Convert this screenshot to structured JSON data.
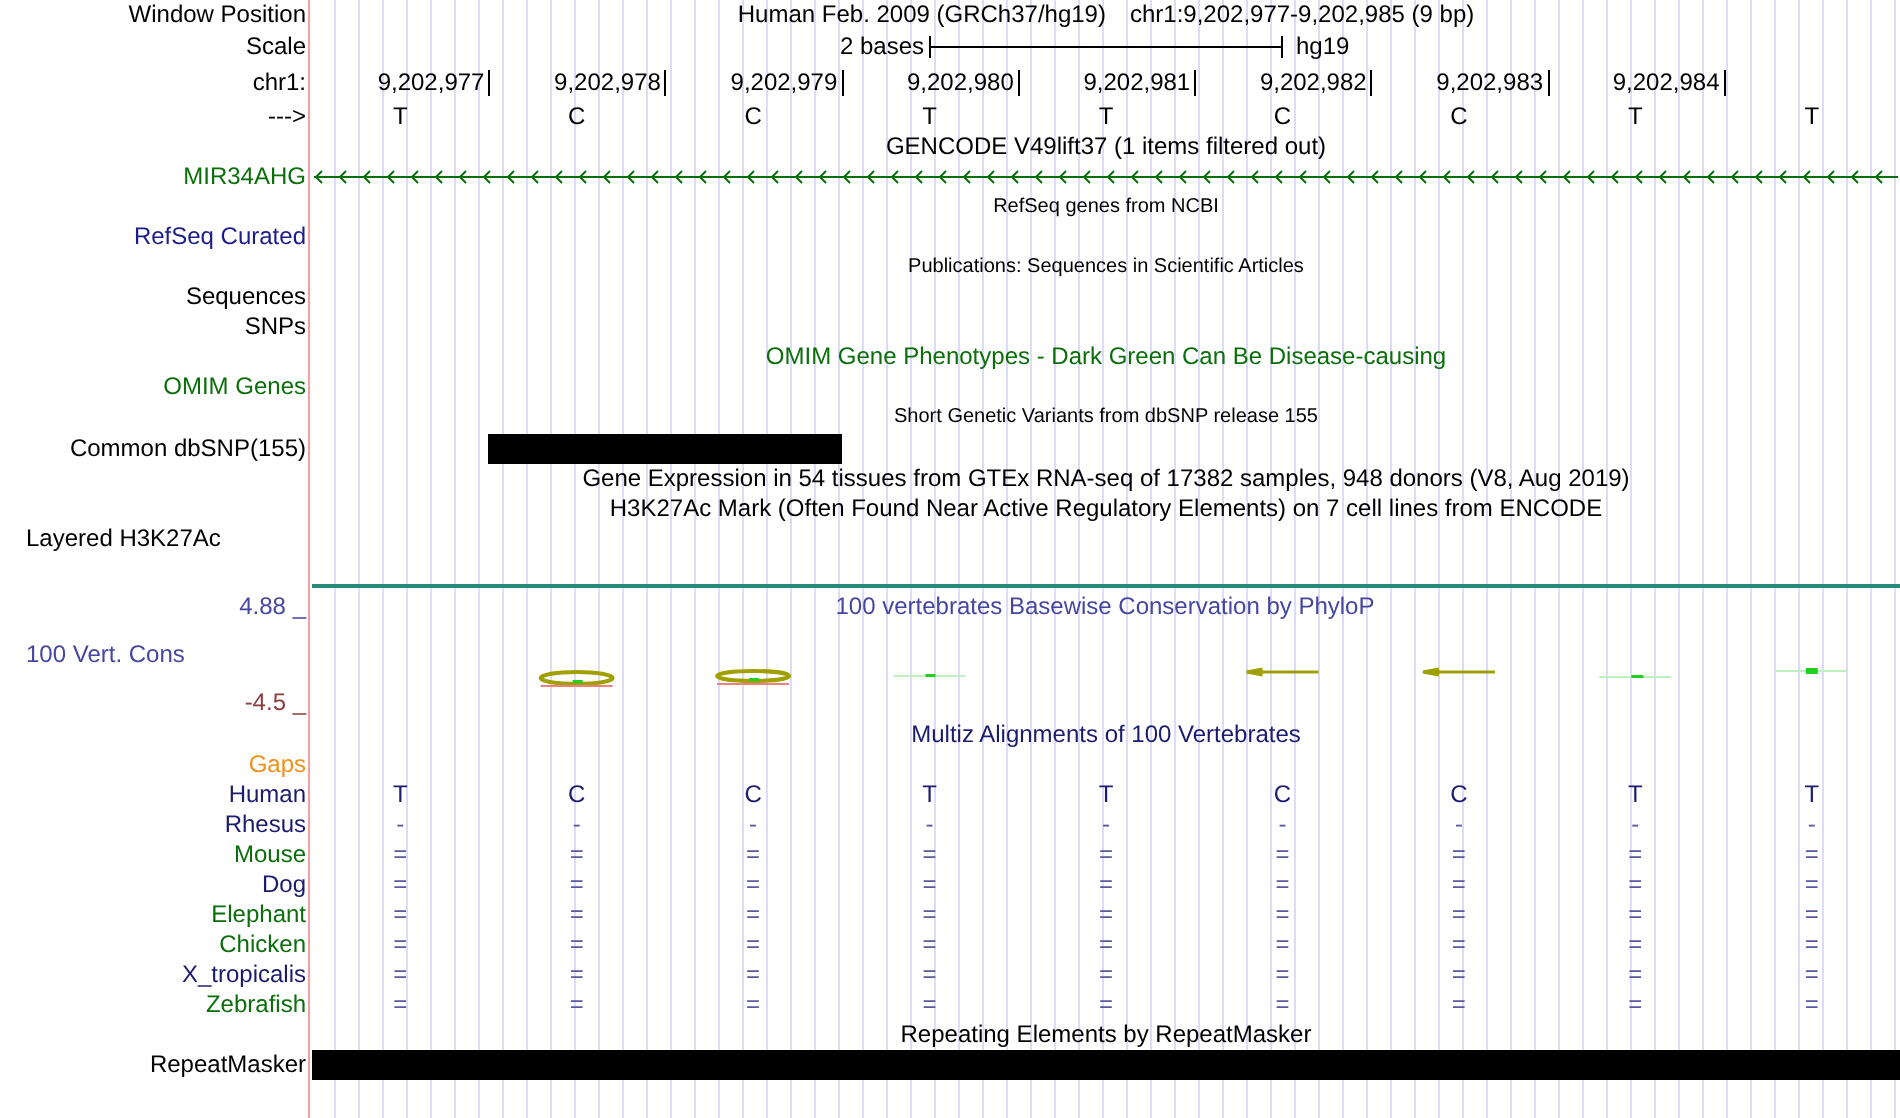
{
  "header": {
    "position_label": "Window Position",
    "assembly_text": "Human Feb. 2009 (GRCh37/hg19)",
    "range_text": "chr1:9,202,977-9,202,985 (9 bp)",
    "scale_label": "Scale",
    "scale_text": "2 bases",
    "scale_db": "hg19",
    "chrom_label": "chr1:",
    "ticks": [
      "9,202,977",
      "9,202,978",
      "9,202,979",
      "9,202,980",
      "9,202,981",
      "9,202,982",
      "9,202,983",
      "9,202,984"
    ],
    "strand_label": "--->",
    "bases": [
      "T",
      "C",
      "C",
      "T",
      "T",
      "C",
      "C",
      "T",
      "T"
    ]
  },
  "rows": [
    {
      "kind": "title",
      "title": "GENCODE V49lift37 (1 items filtered out)",
      "color": "#000000"
    },
    {
      "kind": "gene",
      "label": "MIR34AHG",
      "color": "#0a6e0a"
    },
    {
      "kind": "small-title",
      "title": "RefSeq genes from NCBI",
      "color": "#000000"
    },
    {
      "kind": "label",
      "label": "RefSeq Curated",
      "color": "#1c1c8c"
    },
    {
      "kind": "small-title",
      "title": "Publications: Sequences in Scientific Articles",
      "color": "#000000"
    },
    {
      "kind": "label",
      "label": "Sequences",
      "color": "#000000"
    },
    {
      "kind": "label",
      "label": "SNPs",
      "color": "#000000"
    },
    {
      "kind": "title",
      "title": "OMIM Gene Phenotypes - Dark Green Can Be Disease-causing",
      "color": "#0a6e0a"
    },
    {
      "kind": "label",
      "label": "OMIM Genes",
      "color": "#0a6e0a"
    },
    {
      "kind": "small-title",
      "title": "Short Genetic Variants from dbSNP release 155",
      "color": "#000000"
    },
    {
      "kind": "snp",
      "label": "Common dbSNP(155)",
      "color": "#000000"
    },
    {
      "kind": "title",
      "title": "Gene Expression in 54 tissues from GTEx RNA-seq of 17382 samples, 948 donors (V8, Aug 2019)",
      "color": "#000000"
    },
    {
      "kind": "title",
      "title": "H3K27Ac Mark (Often Found Near Active Regulatory Elements) on 7 cell lines from ENCODE",
      "color": "#000000"
    },
    {
      "kind": "composite",
      "label": "Layered H3K27Ac",
      "color": "#000000"
    },
    {
      "kind": "wiggle",
      "max_label": "4.88 _",
      "label": "100 Vert. Cons",
      "min_label": "-4.5 _",
      "title": "100 vertebrates Basewise Conservation by PhyloP",
      "color": "#4646a0"
    },
    {
      "kind": "title",
      "title": "Multiz Alignments of 100 Vertebrates",
      "color": "#1c1c6e"
    },
    {
      "kind": "label",
      "label": "Gaps",
      "color": "#f0901a"
    },
    {
      "kind": "species",
      "label": "Human",
      "color": "#1c1c6e",
      "cells": [
        "T",
        "C",
        "C",
        "T",
        "T",
        "C",
        "C",
        "T",
        "T"
      ]
    },
    {
      "kind": "species",
      "label": "Rhesus",
      "color": "#1c1c6e",
      "cells": [
        "-",
        "-",
        "-",
        "-",
        "-",
        "-",
        "-",
        "-",
        "-"
      ]
    },
    {
      "kind": "species",
      "label": "Mouse",
      "color": "#0a6e0a",
      "cells": [
        "=",
        "=",
        "=",
        "=",
        "=",
        "=",
        "=",
        "=",
        "="
      ]
    },
    {
      "kind": "species",
      "label": "Dog",
      "color": "#1c1c6e",
      "cells": [
        "=",
        "=",
        "=",
        "=",
        "=",
        "=",
        "=",
        "=",
        "="
      ]
    },
    {
      "kind": "species",
      "label": "Elephant",
      "color": "#0a6e0a",
      "cells": [
        "=",
        "=",
        "=",
        "=",
        "=",
        "=",
        "=",
        "=",
        "="
      ]
    },
    {
      "kind": "species",
      "label": "Chicken",
      "color": "#0a6e0a",
      "cells": [
        "=",
        "=",
        "=",
        "=",
        "=",
        "=",
        "=",
        "=",
        "="
      ]
    },
    {
      "kind": "species",
      "label": "X_tropicalis",
      "color": "#1c1c6e",
      "cells": [
        "=",
        "=",
        "=",
        "=",
        "=",
        "=",
        "=",
        "=",
        "="
      ]
    },
    {
      "kind": "species",
      "label": "Zebrafish",
      "color": "#0a6e0a",
      "cells": [
        "=",
        "=",
        "=",
        "=",
        "=",
        "=",
        "=",
        "=",
        "="
      ]
    },
    {
      "kind": "title",
      "title": "Repeating Elements by RepeatMasker",
      "color": "#000000"
    },
    {
      "kind": "repeat",
      "label": "RepeatMasker",
      "color": "#000000"
    }
  ]
}
